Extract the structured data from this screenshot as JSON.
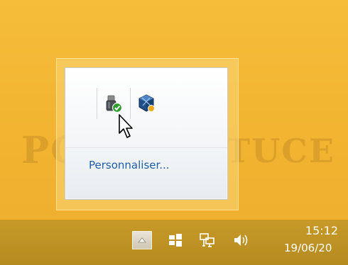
{
  "notification_area_flyout": {
    "icons": [
      {
        "name": "usb-safely-remove-icon"
      },
      {
        "name": "virtualbox-icon"
      }
    ],
    "customize_link": "Personnaliser..."
  },
  "watermark": {
    "left": "PC",
    "right": "ASTUCES"
  },
  "taskbar": {
    "show_hidden_icon": "chevron-up-icon",
    "tray_icons": [
      "action-center-icon",
      "network-icon",
      "volume-icon"
    ],
    "clock_time": "15:12",
    "clock_date": "19/06/20"
  },
  "colors": {
    "desktop": "#f2b735",
    "taskbar": "#bf9226",
    "link": "#1f5da8"
  }
}
